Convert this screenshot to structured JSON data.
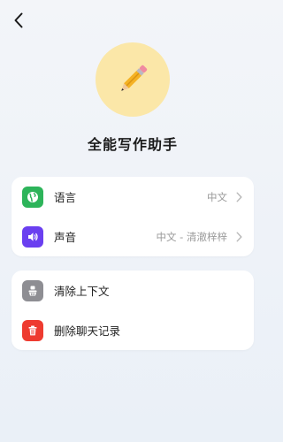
{
  "header": {
    "back_icon": "chevron-left-icon"
  },
  "profile": {
    "avatar_icon": "pencil-icon",
    "avatar_bg": "#fbe7a8",
    "title": "全能写作助手"
  },
  "settings": {
    "language": {
      "label": "语言",
      "value": "中文",
      "icon": "globe-icon",
      "color": "#2db45a"
    },
    "voice": {
      "label": "声音",
      "value": "中文 - 清澈梓梓",
      "icon": "speaker-icon",
      "color": "#6a3ff0"
    }
  },
  "actions": {
    "clear_context": {
      "label": "清除上下文",
      "icon": "clear-context-icon",
      "color": "#8e8e93"
    },
    "delete_history": {
      "label": "删除聊天记录",
      "icon": "trash-icon",
      "color": "#ee3b30"
    }
  }
}
